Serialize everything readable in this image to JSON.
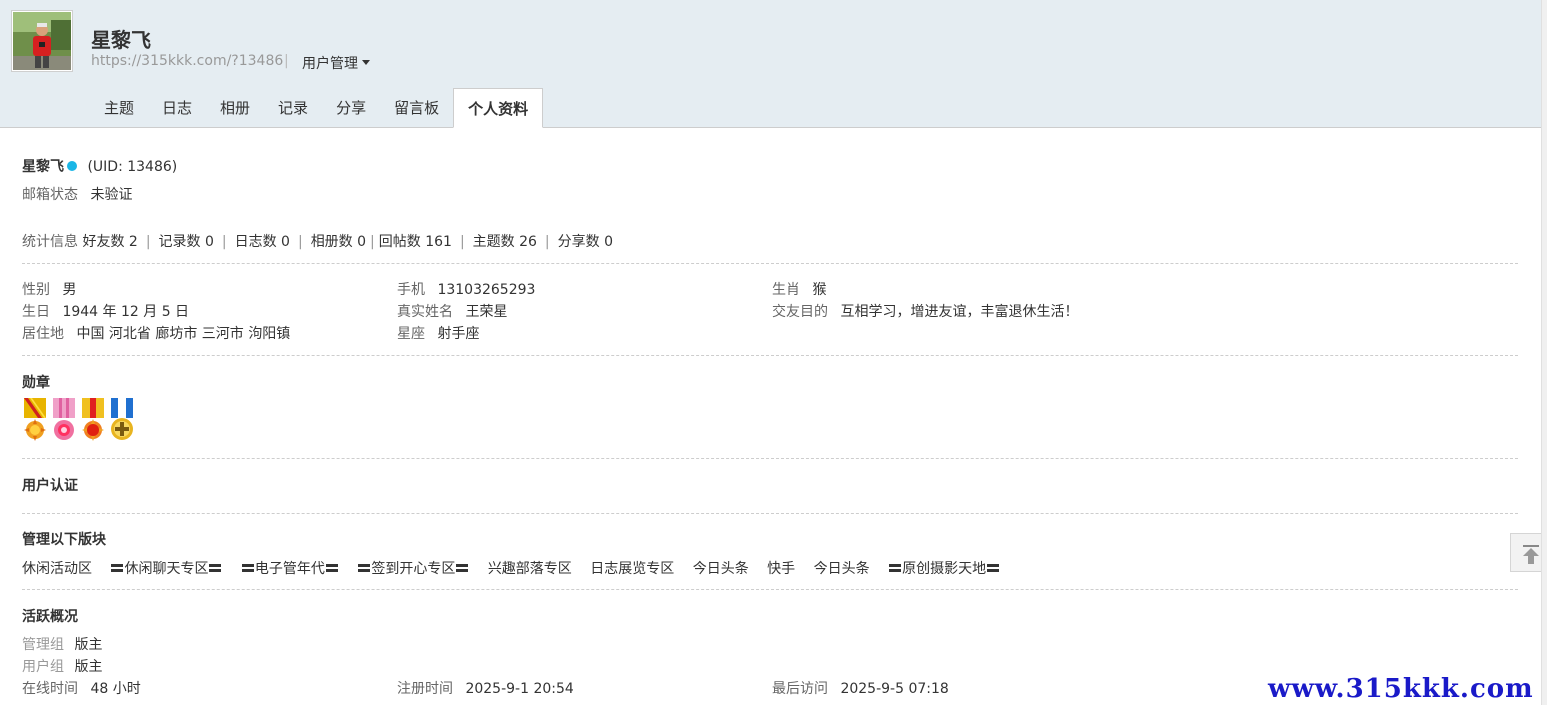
{
  "header": {
    "username": "星黎飞",
    "space_url": "https://315kkk.com/?13486",
    "separator": "|",
    "user_menu_label": "用户管理"
  },
  "tabs": [
    {
      "label": "主题"
    },
    {
      "label": "日志"
    },
    {
      "label": "相册"
    },
    {
      "label": "记录"
    },
    {
      "label": "分享"
    },
    {
      "label": "留言板"
    },
    {
      "label": "个人资料",
      "active": true
    }
  ],
  "profile": {
    "name": "星黎飞",
    "uid_text": "(UID: 13486)",
    "email_status_label": "邮箱状态",
    "email_status_value": "未验证",
    "online_dot_color": "#1ab6e6"
  },
  "stats": {
    "label": "统计信息",
    "items": [
      {
        "text": "好友数 2"
      },
      {
        "text": "记录数 0"
      },
      {
        "text": "日志数 0"
      },
      {
        "text": "相册数 0"
      },
      {
        "text": "回帖数 161"
      },
      {
        "text": "主题数 26"
      },
      {
        "text": "分享数 0"
      }
    ]
  },
  "details": {
    "gender_label": "性别",
    "gender": "男",
    "birthday_label": "生日",
    "birthday": "1944 年 12 月 5 日",
    "residence_label": "居住地",
    "residence": "中国 河北省 廊坊市 三河市 泃阳镇",
    "phone_label": "手机",
    "phone": "13103265293",
    "realname_label": "真实姓名",
    "realname": "王荣星",
    "constellation_label": "星座",
    "constellation": "射手座",
    "zodiac_label": "生肖",
    "zodiac": "猴",
    "purpose_label": "交友目的",
    "purpose": "互相学习，增进友谊，丰富退休生活！"
  },
  "medals": {
    "title": "勋章",
    "icons": [
      "medal-sun-icon",
      "medal-pink-icon",
      "medal-red-star-icon",
      "medal-blue-cross-icon"
    ]
  },
  "verification": {
    "title": "用户认证"
  },
  "moderated": {
    "title": "管理以下版块",
    "forums": [
      {
        "label": "休闲活动区",
        "bars": false
      },
      {
        "label": "休闲聊天专区",
        "bars": true
      },
      {
        "label": "电子管年代",
        "bars": true
      },
      {
        "label": "签到开心专区",
        "bars": true
      },
      {
        "label": "兴趣部落专区",
        "bars": false
      },
      {
        "label": "日志展览专区",
        "bars": false
      },
      {
        "label": "今日头条",
        "bars": false
      },
      {
        "label": "快手",
        "bars": false
      },
      {
        "label": "今日头条",
        "bars": false
      },
      {
        "label": "原创摄影天地",
        "bars": true
      }
    ]
  },
  "activity": {
    "title": "活跃概况",
    "admin_group_label": "管理组",
    "admin_group": "版主",
    "user_group_label": "用户组",
    "user_group": "版主",
    "online_time_label": "在线时间",
    "online_time": "48 小时",
    "register_time_label": "注册时间",
    "register_time": "2025-9-1 20:54",
    "last_visit_label": "最后访问",
    "last_visit": "2025-9-5 07:18"
  },
  "watermark": "www.315kkk.com",
  "colors": {
    "header_bg": "#e5edf2",
    "watermark": "#1a1ac8"
  }
}
